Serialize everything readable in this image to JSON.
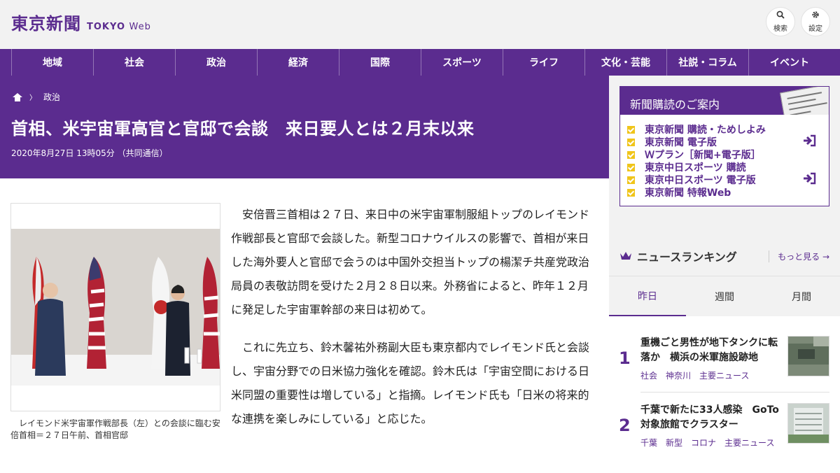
{
  "header": {
    "logo_jp": "東京新聞",
    "logo_en": "TOKYO",
    "logo_web": "Web",
    "search_label": "検索",
    "settings_label": "設定"
  },
  "nav": [
    "地域",
    "社会",
    "政治",
    "経済",
    "国際",
    "スポーツ",
    "ライフ",
    "文化・芸能",
    "社説・コラム",
    "イベント"
  ],
  "article": {
    "breadcrumb": "政治",
    "title": "首相、米宇宙軍高官と官邸で会談　来日要人とは２月末以来",
    "date": "2020年8月27日 13時05分 （共同通信）",
    "caption": "レイモンド米宇宙軍作戦部長（左）との会談に臨む安倍首相＝２７日午前、首相官邸",
    "paragraphs": [
      "安倍晋三首相は２７日、来日中の米宇宙軍制服組トップのレイモンド作戦部長と官邸で会談した。新型コロナウイルスの影響で、首相が来日した海外要人と官邸で会うのは中国外交担当トップの楊潔チ共産党政治局員の表敬訪問を受けた２月２８日以来。外務省によると、昨年１２月に発足した宇宙軍幹部の来日は初めて。",
      "これに先立ち、鈴木馨祐外務副大臣も東京都内でレイモンド氏と会談し、宇宙分野での日米協力強化を確認。鈴木氏は「宇宙空間における日米同盟の重要性は増している」と指摘。レイモンド氏も「日米の将来的な連携を楽しみにしている」と応じた。"
    ]
  },
  "subscription": {
    "title": "新聞購読のご案内",
    "items": [
      {
        "label": "東京新聞 購読・ためしよみ",
        "icon": ""
      },
      {
        "label": "東京新聞 電子版",
        "icon": "login-icon"
      },
      {
        "label": "Ｗプラン［新聞+電子版］",
        "icon": ""
      },
      {
        "label": "東京中日スポーツ 購読",
        "icon": ""
      },
      {
        "label": "東京中日スポーツ 電子版",
        "icon": "login-icon"
      },
      {
        "label": "東京新聞 特報Web",
        "icon": ""
      }
    ]
  },
  "ranking": {
    "title": "ニュースランキング",
    "more": "もっと見る",
    "tabs": [
      "昨日",
      "週間",
      "月間"
    ],
    "active_tab": 0,
    "items": [
      {
        "rank": "1",
        "title": "重機ごと男性が地下タンクに転落か　横浜の米軍施設跡地",
        "tags": [
          "社会",
          "神奈川",
          "主要ニュース"
        ]
      },
      {
        "rank": "2",
        "title": "千葉で新たに33人感染　GoTo対象旅館でクラスター",
        "tags": [
          "千葉",
          "新型",
          "コロナ",
          "主要ニュース"
        ]
      }
    ]
  },
  "colors": {
    "brand": "#5b2c8f",
    "accent": "#f0c51a",
    "bg": "#f2f2f2"
  }
}
